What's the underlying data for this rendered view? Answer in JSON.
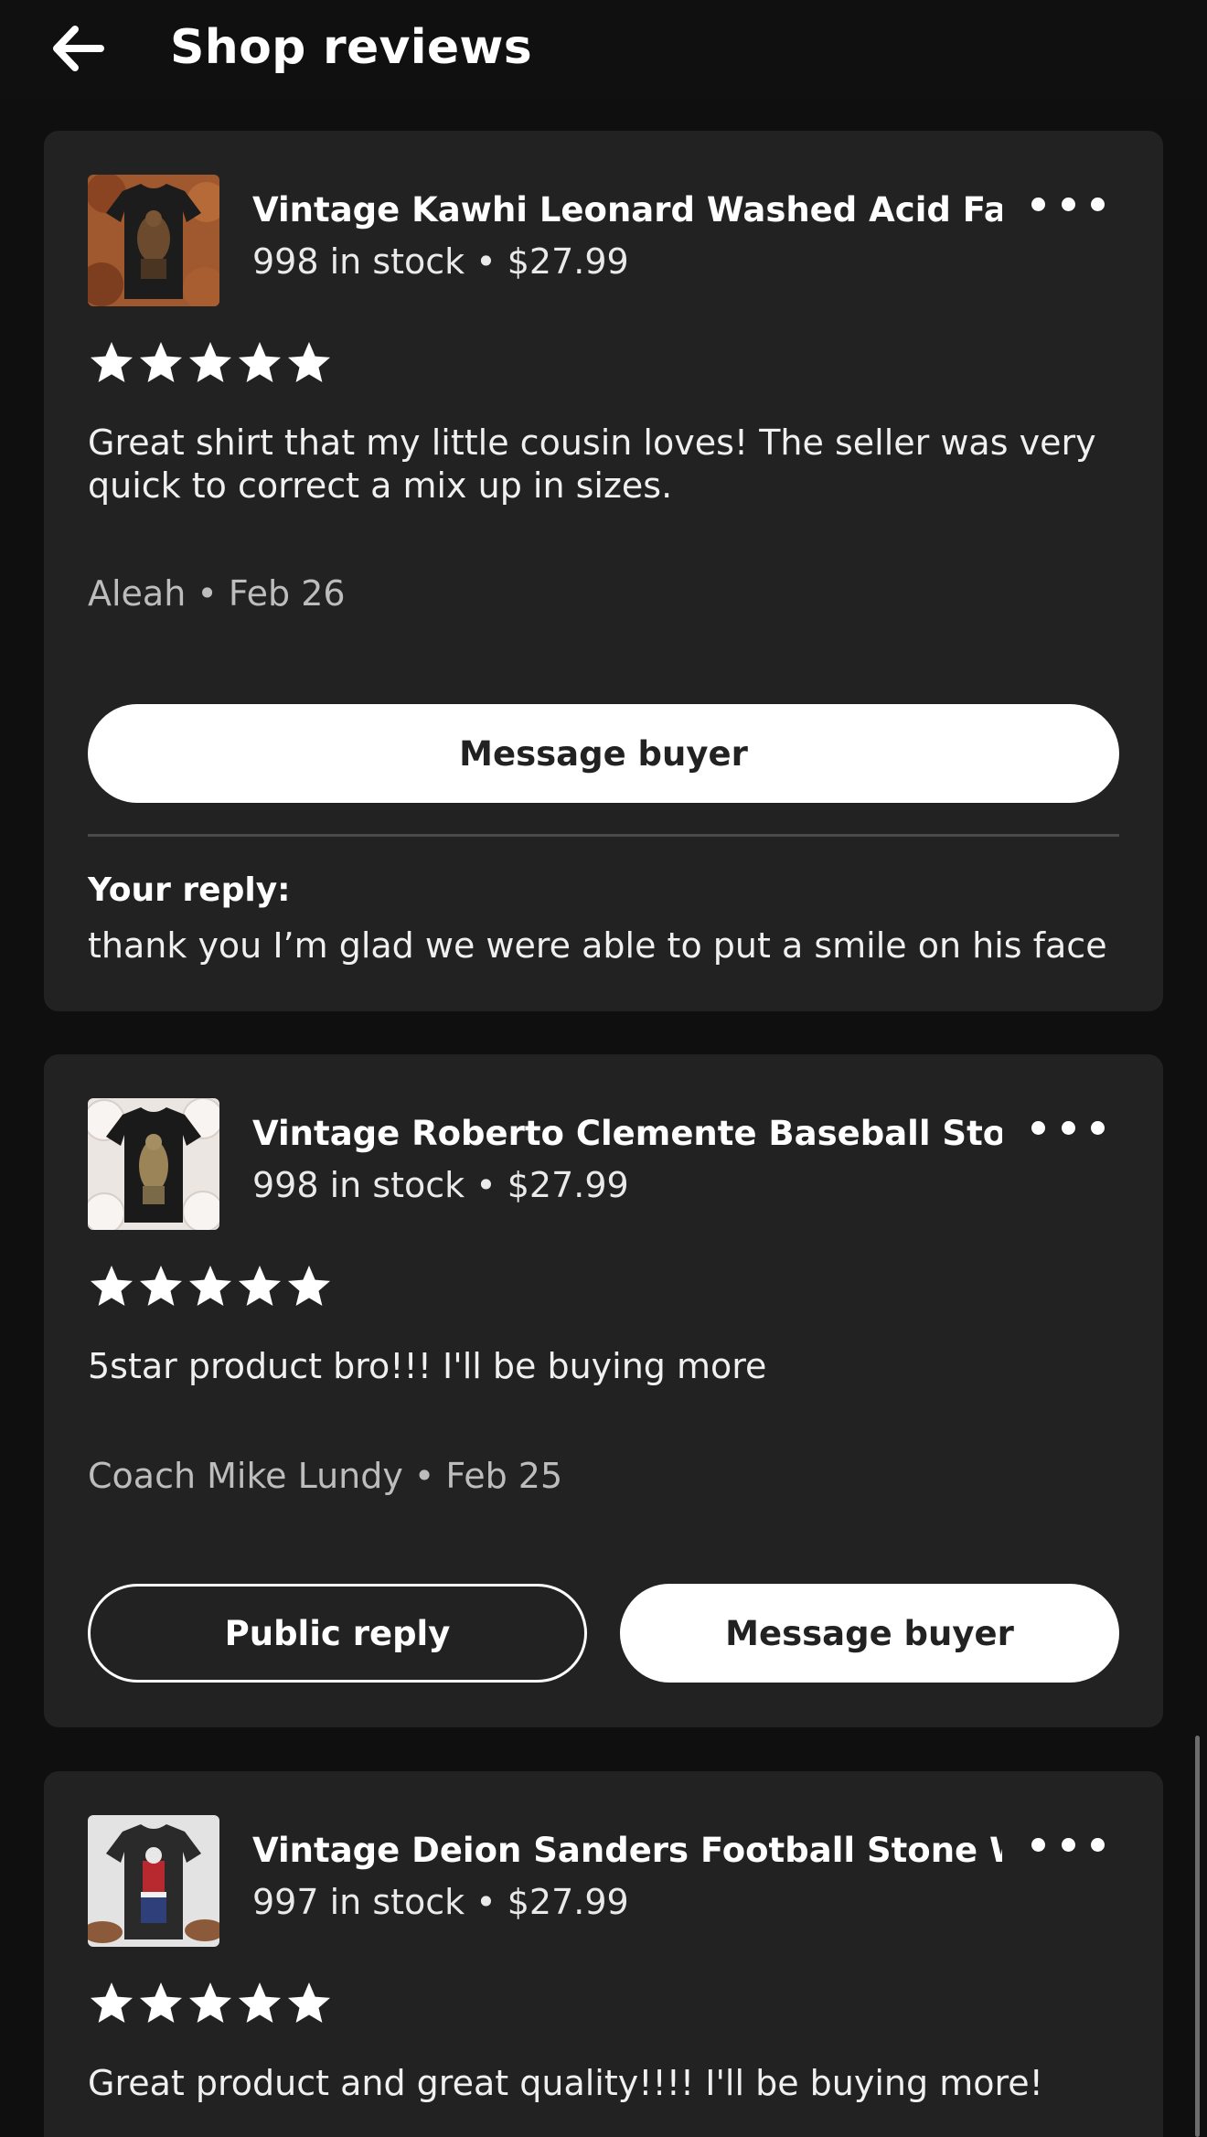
{
  "header": {
    "title": "Shop reviews",
    "back_icon": "arrow-left-icon"
  },
  "reviews": [
    {
      "product_title": "Vintage Kawhi Leonard Washed Acid Fa...",
      "product_meta": "998 in stock • $27.99",
      "rating": 5,
      "text": "Great shirt that my little cousin loves! The seller was very quick to correct a mix up in sizes.",
      "reviewer": "Aleah • Feb 26",
      "message_label": "Message buyer",
      "reply_label": "Your reply:",
      "reply_text": "thank you I’m glad we were able to put a smile on his face"
    },
    {
      "product_title": "Vintage Roberto Clemente Baseball Sto...",
      "product_meta": "998 in stock • $27.99",
      "rating": 5,
      "text": "5star product  bro!!! I'll  be buying more",
      "reviewer": "Coach Mike Lundy • Feb 25",
      "public_reply_label": "Public reply",
      "message_label": "Message buyer"
    },
    {
      "product_title": "Vintage Deion Sanders Football Stone W...",
      "product_meta": "997 in stock • $27.99",
      "rating": 5,
      "text": "Great product and great quality!!!! I'll  be buying more!"
    }
  ],
  "icons": {
    "more": "more-options-icon",
    "star": "star-icon"
  },
  "colors": {
    "background": "#0f0f0f",
    "card": "#222222",
    "text": "#ffffff",
    "muted": "#bdbdbd",
    "button_fill": "#ffffff"
  }
}
